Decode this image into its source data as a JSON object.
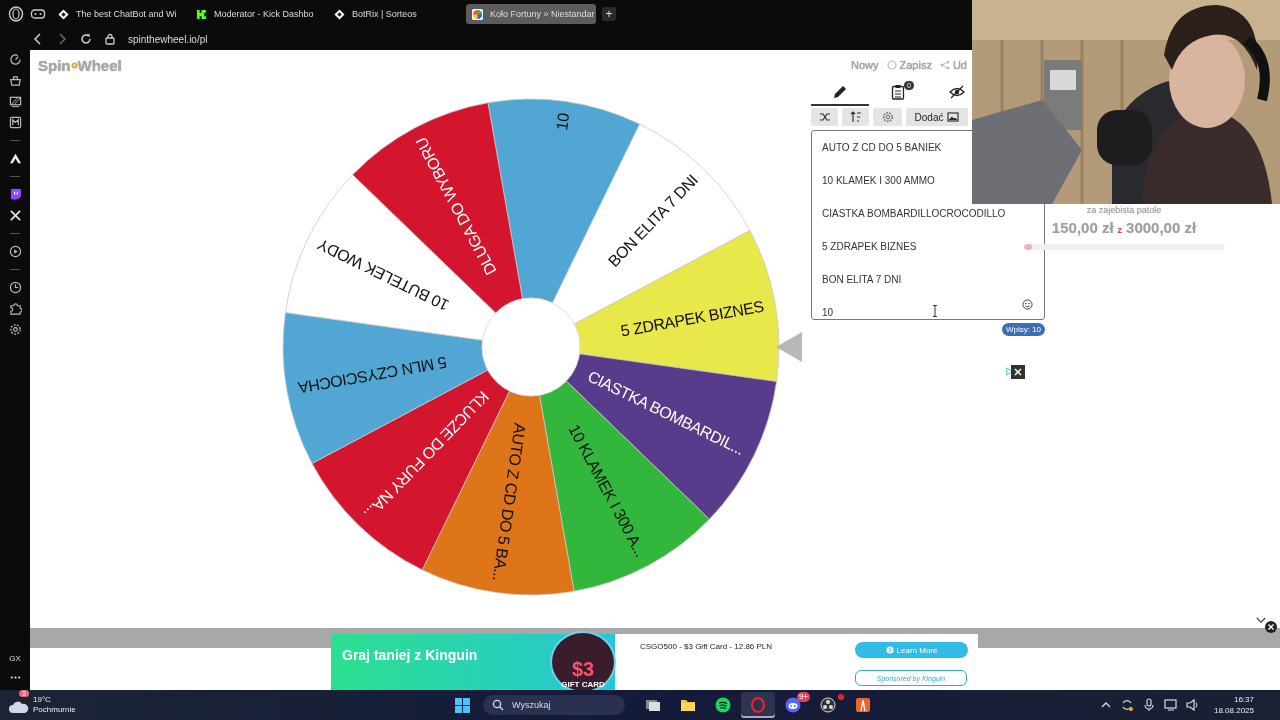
{
  "browser": {
    "tabs": [
      {
        "title": "The best ChatBot and Wi",
        "kind": "diamond",
        "selected": false
      },
      {
        "title": "Moderator - Kick Dashbo",
        "kind": "square",
        "selected": false
      },
      {
        "title": "BotRix | Sorteos",
        "kind": "diamond",
        "selected": false
      },
      {
        "title": "Koło Fortuny » Niestandar",
        "kind": "wheel",
        "selected": true
      }
    ],
    "new_tab": "+",
    "url": "spinthewheel.io/pl"
  },
  "sidebar": {
    "label": "GX"
  },
  "app": {
    "logo": [
      "Spin",
      "Wheel"
    ],
    "toolbar": [
      "Nowy",
      "Zapisz",
      "Ud"
    ],
    "panel_tabs": [
      {
        "kind": "edit",
        "selected": true
      },
      {
        "kind": "results",
        "badge": "0",
        "selected": false
      },
      {
        "kind": "hide",
        "selected": false
      }
    ],
    "add_button": "Dodać",
    "entries": [
      "AUTO Z CD DO 5 BANIEK",
      "10 KLAMEK I 300 AMMO",
      "CIASTKA BOMBARDILLOCROCODILLO",
      "5 ZDRAPEK BIZNES",
      "BON ELITA 7 DNI",
      "10"
    ],
    "entry_count": "Wpisy: 10",
    "wheel": {
      "segments": [
        {
          "label": "10",
          "color": "#52a6d3"
        },
        {
          "label": "BON ELITA 7 DNI",
          "color": "#ffffff"
        },
        {
          "label": "5 ZDRAPEK BIZNES",
          "color": "#e8e84a"
        },
        {
          "label": "CIASTKA BOMBARDIL...",
          "color": "#583b8a"
        },
        {
          "label": "10 KLAMEK I 300 A...",
          "color": "#32b63b"
        },
        {
          "label": "AUTO Z CD DO 5 BA...",
          "color": "#de7518"
        },
        {
          "label": "KLUCZE DO FURY NA...",
          "color": "#d3152d"
        },
        {
          "label": "5 MLN CZYSCIOCHA",
          "color": "#52a6d3"
        },
        {
          "label": "10 BUTELEK WODY",
          "color": "#ffffff"
        },
        {
          "label": "DLUGA DO WYBORU",
          "color": "#d3152d"
        }
      ]
    }
  },
  "stream_overlay": {
    "goal_title": "za zajebista patole",
    "raised": "150,00 zł",
    "separator": "z",
    "target": "3000,00 zł",
    "level": 0.04
  },
  "ad": {
    "headline": "Graj taniej z Kinguin",
    "badge_amount": "$3",
    "badge_caption": "GIFT CARD",
    "offer": "CSGO500 - $3 Gift Card - 12.86 PLN",
    "cta": "Learn More",
    "sponsor": "Sponsored by Kinguin"
  },
  "taskbar": {
    "weather": {
      "badge": "3",
      "temperature": "19°C",
      "condition": "Pochmurnie"
    },
    "search_placeholder": "Wyszukaj",
    "apps": [
      {
        "kind": "taskview",
        "active": false
      },
      {
        "kind": "folder",
        "active": false
      },
      {
        "kind": "music",
        "active": false
      },
      {
        "kind": "ring",
        "active": true
      },
      {
        "kind": "chat",
        "active": false,
        "badge": "9+"
      },
      {
        "kind": "record",
        "active": false
      },
      {
        "kind": "road",
        "active": false
      }
    ],
    "time": "16:37",
    "date": "18.08.2025"
  }
}
